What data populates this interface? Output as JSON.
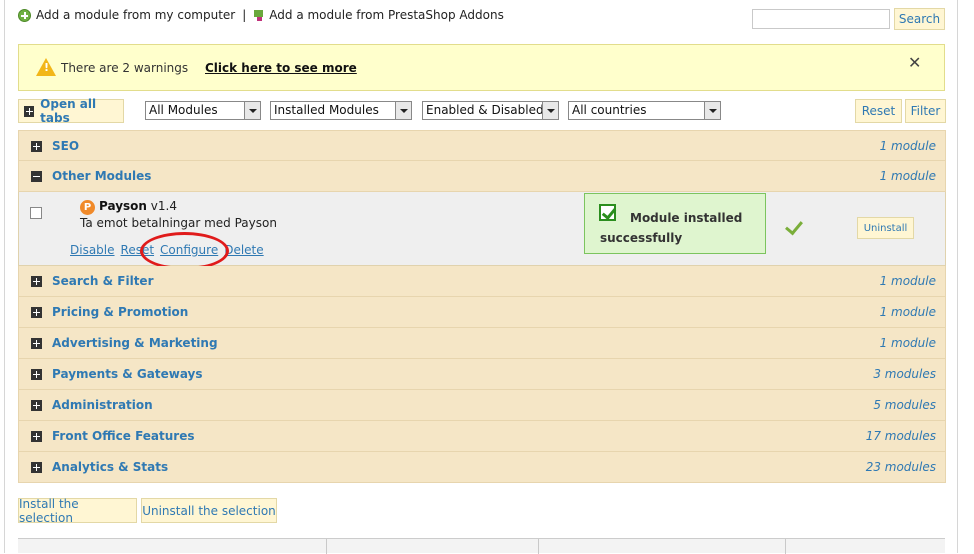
{
  "topbar": {
    "add_from_computer": "Add a module from my computer",
    "separator": "|",
    "add_from_addons": "Add a module from PrestaShop Addons"
  },
  "search": {
    "value": "",
    "placeholder": "",
    "button": "Search"
  },
  "warning": {
    "text": "There are 2 warnings",
    "link": "Click here to see more",
    "close": "✕"
  },
  "filters": {
    "open_all_tabs": "Open all tabs",
    "modules": "All Modules",
    "installed": "Installed Modules",
    "status": "Enabled & Disabled",
    "countries": "All countries",
    "reset": "Reset",
    "filter": "Filter"
  },
  "categories_top": [
    {
      "name": "SEO",
      "count": "1 module",
      "expanded": false
    },
    {
      "name": "Other Modules",
      "count": "1 module",
      "expanded": true
    }
  ],
  "module": {
    "logo_letter": "P",
    "name": "Payson",
    "version": "v1.4",
    "description": "Ta emot betalningar med Payson",
    "actions": [
      "Disable",
      "Reset",
      "Configure",
      "Delete"
    ],
    "success_message": "Module installed successfully",
    "uninstall": "Uninstall"
  },
  "categories_bottom": [
    {
      "name": "Search & Filter",
      "count": "1 module"
    },
    {
      "name": "Pricing & Promotion",
      "count": "1 module"
    },
    {
      "name": "Advertising & Marketing",
      "count": "1 module"
    },
    {
      "name": "Payments & Gateways",
      "count": "3 modules"
    },
    {
      "name": "Administration",
      "count": "5 modules"
    },
    {
      "name": "Front Office Features",
      "count": "17 modules"
    },
    {
      "name": "Analytics & Stats",
      "count": "23 modules"
    }
  ],
  "bulk": {
    "install_selection": "Install the selection",
    "uninstall_selection": "Uninstall the selection"
  },
  "colors": {
    "link": "#2f79b3",
    "category_bg": "#f5e6c6",
    "warning_bg": "#ffffcc",
    "success_bg": "#dff5cf"
  }
}
